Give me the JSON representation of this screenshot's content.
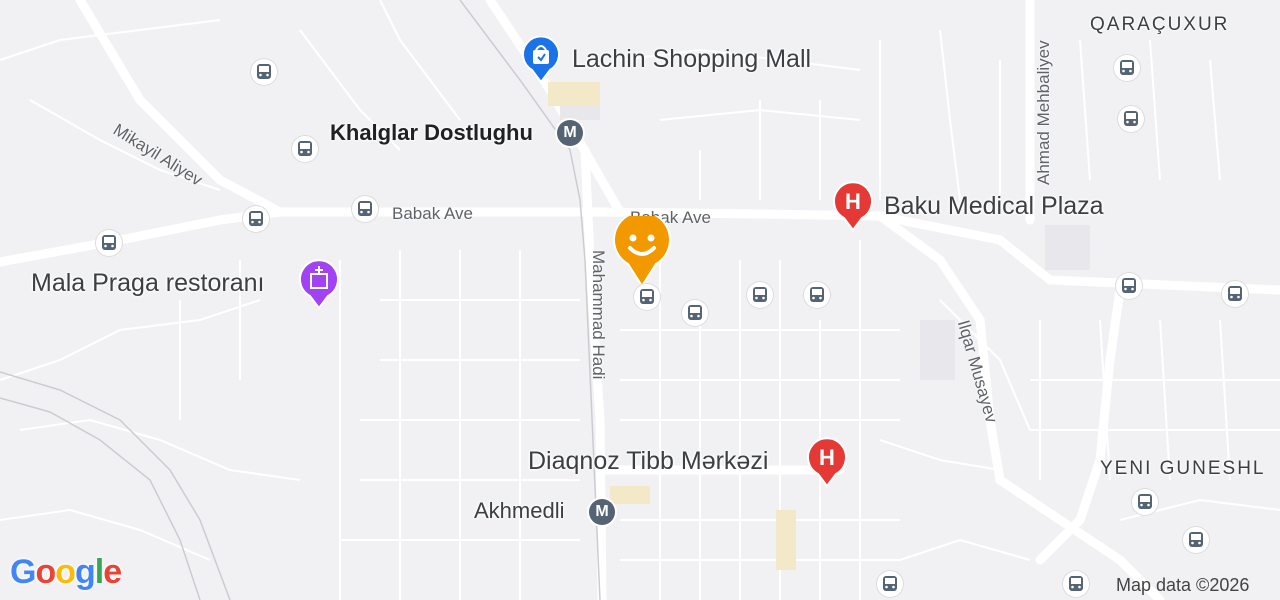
{
  "map": {
    "pois": {
      "lachin": {
        "label": "Lachin Shopping Mall",
        "icon": "shopping-bag-icon",
        "color": "#1a73e8"
      },
      "medical_plaza": {
        "label": "Baku Medical Plaza",
        "icon": "hospital-icon",
        "color": "#e53935"
      },
      "diaqnoz": {
        "label": "Diaqnoz Tibb Mərkəzi",
        "icon": "hospital-icon",
        "color": "#e53935"
      },
      "mala_praga": {
        "label": "Mala Praga restoranı",
        "icon": "landmark-icon",
        "color": "#a142f4"
      }
    },
    "metro": {
      "khalglar": {
        "label": "Khalglar Dostlughu",
        "symbol": "M"
      },
      "akhmedli": {
        "label": "Akhmedli",
        "symbol": "M"
      }
    },
    "streets": {
      "babak_ave_1": "Babak Ave",
      "babak_ave_2": "Babak Ave",
      "mikayil": "Mikayil Aliyev",
      "mahammad": "Mahammad Hadi",
      "ahmad": "Ahmad Mehbaliyev",
      "ilqar": "Ilqar Musayev"
    },
    "districts": {
      "qaracuxur": "QARAÇUXUR",
      "yeni_guneshli": "YENI GUNESHL"
    },
    "user_marker": {
      "icon": "smiley-pin-icon",
      "color": "#f29900"
    },
    "bus_icon": "bus-stop-icon",
    "attribution": "Map data ©2026",
    "logo": "Google"
  }
}
